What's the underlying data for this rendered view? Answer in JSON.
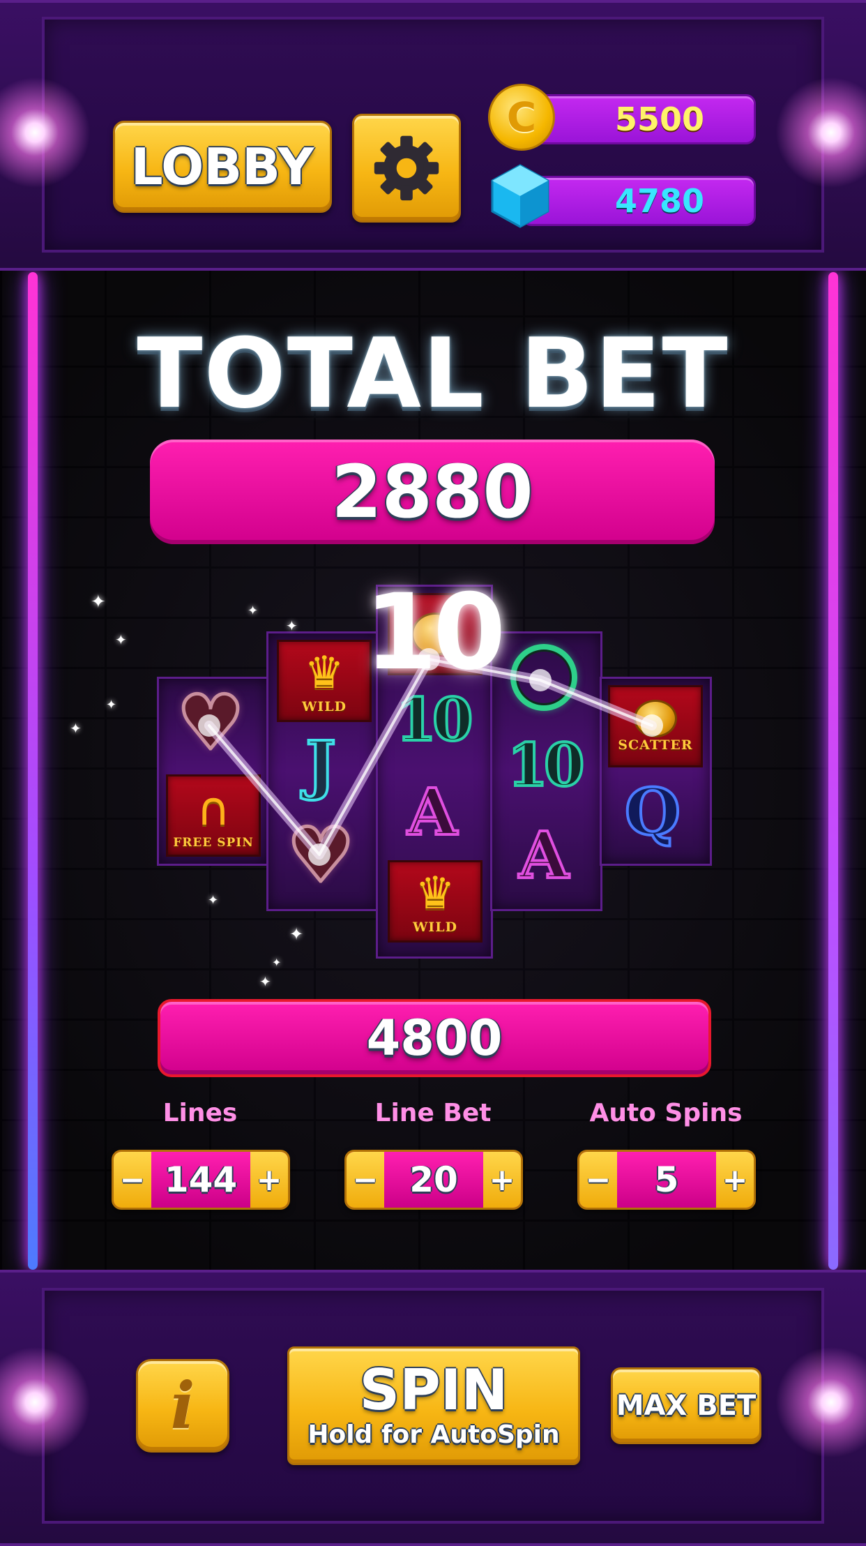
{
  "header": {
    "lobby_label": "LOBBY",
    "settings_icon": "gear-icon",
    "coins": "5500",
    "gems": "4780"
  },
  "bet": {
    "title": "TOTAL BET",
    "total": "2880",
    "win_amount": "4800",
    "win_multiplier": "10"
  },
  "reels": {
    "tile_labels": {
      "wild": "WILD",
      "free_spin": "FREE SPIN",
      "scatter": "SCATTER"
    },
    "card_glyphs": {
      "jack": "J",
      "ten": "10",
      "ace": "A",
      "queen": "Q"
    }
  },
  "controls": {
    "lines": {
      "label": "Lines",
      "value": "144"
    },
    "line_bet": {
      "label": "Line Bet",
      "value": "20"
    },
    "auto_spins": {
      "label": "Auto Spins",
      "value": "5"
    },
    "minus": "−",
    "plus": "+"
  },
  "footer": {
    "info_label": "i",
    "spin_label": "SPIN",
    "spin_sub": "Hold for AutoSpin",
    "max_bet_label": "MAX BET"
  },
  "colors": {
    "accent_pink": "#ff1fb0",
    "gold": "#f7b614",
    "purple_panel": "#2f0c52",
    "coin_text": "#fff36a",
    "gem_text": "#39e6ff"
  }
}
